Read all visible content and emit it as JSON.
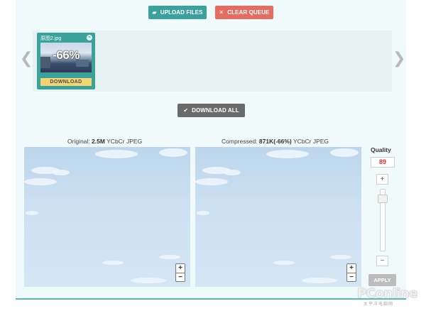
{
  "toolbar": {
    "upload_label": "UPLOAD FILES",
    "upload_icon": "folder-open-icon",
    "clear_label": "CLEAR QUEUE",
    "clear_icon": "x-icon",
    "upload_color": "#3aa19b",
    "clear_color": "#e46c60"
  },
  "queue": {
    "prev_glyph": "❮",
    "next_glyph": "❯",
    "items": [
      {
        "filename": "原图2.jpg",
        "savings": "-66%",
        "download_label": "DOWNLOAD",
        "close_glyph": "✕"
      }
    ]
  },
  "download_all": {
    "label": "DOWNLOAD ALL",
    "icon_glyph": "✔"
  },
  "compare": {
    "original_prefix": "Original: ",
    "original_size": "2.5M",
    "original_suffix": " YCbCr JPEG",
    "compressed_prefix": "Compressed: ",
    "compressed_size": "871K(-66%)",
    "compressed_suffix": " YCbCr JPEG"
  },
  "zoom": {
    "plus": "+",
    "minus": "−"
  },
  "quality": {
    "title": "Quality",
    "value": "89",
    "level": 89,
    "plus": "+",
    "minus": "−",
    "apply_label": "APPLY"
  },
  "watermark": {
    "logo": "PConline",
    "sub": "太平洋电脑网"
  }
}
